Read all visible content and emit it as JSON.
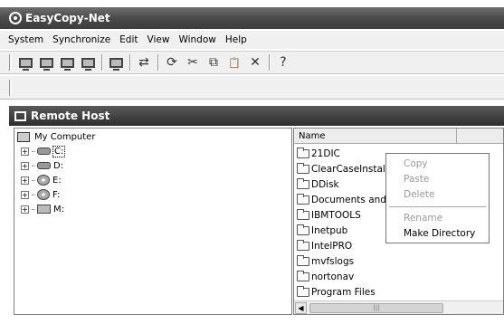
{
  "window": {
    "title": "EasyCopy-Net"
  },
  "menubar": {
    "items": [
      "System",
      "Synchronize",
      "Edit",
      "View",
      "Window",
      "Help"
    ]
  },
  "toolbar": {
    "buttons": [
      "computer-1",
      "computer-2",
      "computer-3",
      "computer-4",
      "host",
      "sync",
      "refresh",
      "cut",
      "copy",
      "paste",
      "delete",
      "help"
    ],
    "glyphs": {
      "sync": "⇄",
      "refresh": "⟳",
      "cut": "✂",
      "copy": "⧉",
      "paste": "📋",
      "delete": "✕",
      "help": "?"
    }
  },
  "panel": {
    "title": "Remote Host"
  },
  "tree": {
    "root": "My Computer",
    "drives": [
      {
        "label": "C:",
        "icon": "hard-drive-icon"
      },
      {
        "label": "D:",
        "icon": "hard-drive-icon"
      },
      {
        "label": "E:",
        "icon": "cd-drive-icon"
      },
      {
        "label": "F:",
        "icon": "cd-drive-icon"
      },
      {
        "label": "M:",
        "icon": "network-drive-icon"
      }
    ]
  },
  "list": {
    "column": "Name",
    "items": [
      "21DIC",
      "ClearCaseInstall",
      "DDisk",
      "Documents and S",
      "IBMTOOLS",
      "Inetpub",
      "IntelPRO",
      "mvfslogs",
      "nortonav",
      "Program Files"
    ]
  },
  "context_menu": {
    "items": [
      {
        "label": "Copy",
        "enabled": false
      },
      {
        "label": "Paste",
        "enabled": false
      },
      {
        "label": "Delete",
        "enabled": false
      },
      {
        "separator": true
      },
      {
        "label": "Rename",
        "enabled": false
      },
      {
        "label": "Make Directory",
        "enabled": true
      }
    ]
  },
  "scrollbar": {
    "thumb_grip": "|||"
  }
}
